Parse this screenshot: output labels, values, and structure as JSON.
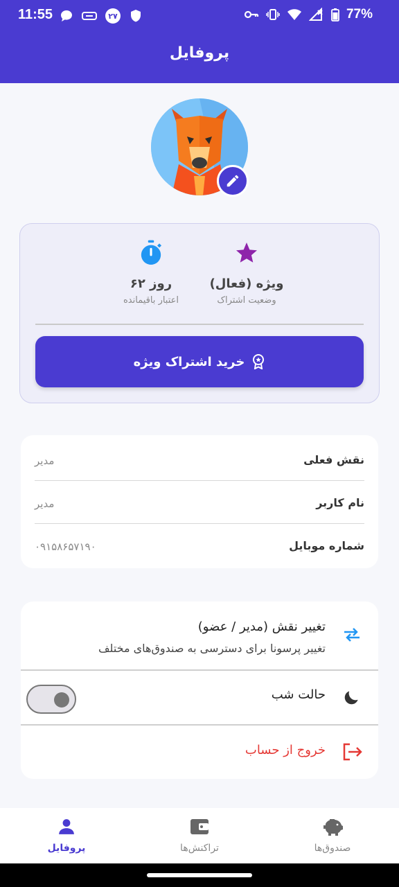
{
  "status_bar": {
    "time": "11:55",
    "notif_badge": "۲۷",
    "battery": "77%"
  },
  "header": {
    "title": "پروفایل"
  },
  "subscription": {
    "status_value": "ویژه (فعال)",
    "status_label": "وضعیت اشتراک",
    "remaining_value": "۶۲ روز",
    "remaining_label": "اعتبار باقیمانده",
    "buy_button": "خرید اشتراک ویژه",
    "colors": {
      "star": "#8e24aa",
      "timer": "#2196f3",
      "accent": "#4a3bd1"
    }
  },
  "info": {
    "rows": [
      {
        "label": "نقش فعلی",
        "value": "مدیر"
      },
      {
        "label": "نام کاربر",
        "value": "مدیر"
      },
      {
        "label": "شماره موبایل",
        "value": "۰۹۱۵۸۶۵۷۱۹۰"
      }
    ]
  },
  "actions": {
    "switch_role_title": "تغییر نقش (مدیر / عضو)",
    "switch_role_sub": "تغییر پرسونا برای دسترسی به صندوق‌های مختلف",
    "dark_mode_label": "حالت شب",
    "dark_mode_on": false,
    "logout_label": "خروج از حساب",
    "logout_color": "#e53935"
  },
  "bottom_nav": {
    "items": [
      {
        "label": "صندوق‌ها",
        "icon": "piggy-bank-icon"
      },
      {
        "label": "تراکنش‌ها",
        "icon": "wallet-icon"
      },
      {
        "label": "پروفایل",
        "icon": "person-icon",
        "active": true
      }
    ]
  }
}
